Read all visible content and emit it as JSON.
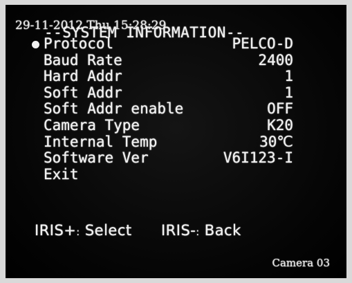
{
  "overlay": {
    "timestamp": "29-11-2012 Thu 15:28:29",
    "title": "--SYSTEM INFORMATION--",
    "camera_label": "Camera 03"
  },
  "menu": {
    "items": [
      {
        "label": "Protocol",
        "value": "PELCO-D",
        "selected": true
      },
      {
        "label": "Baud Rate",
        "value": "2400"
      },
      {
        "label": "Hard Addr",
        "value": "1"
      },
      {
        "label": "Soft Addr",
        "value": "1"
      },
      {
        "label": "Soft Addr enable",
        "value": "OFF"
      },
      {
        "label": "Camera Type",
        "value": "K20"
      },
      {
        "label": "Internal Temp",
        "value": "30℃"
      },
      {
        "label": "Software Ver",
        "value": "V6I123-I"
      },
      {
        "label": "Exit",
        "value": ""
      }
    ]
  },
  "hints": {
    "select_key": "IRIS+",
    "select_sep": ":",
    "select_text": "Select",
    "back_key": "IRIS-",
    "back_sep": ":",
    "back_text": "Back"
  },
  "colors": {
    "osd_text": "#f2f2f2",
    "screen_bg": "#050505",
    "frame_border": "#d9d9d9"
  },
  "icons": {
    "selection_marker": "bullet-icon"
  }
}
